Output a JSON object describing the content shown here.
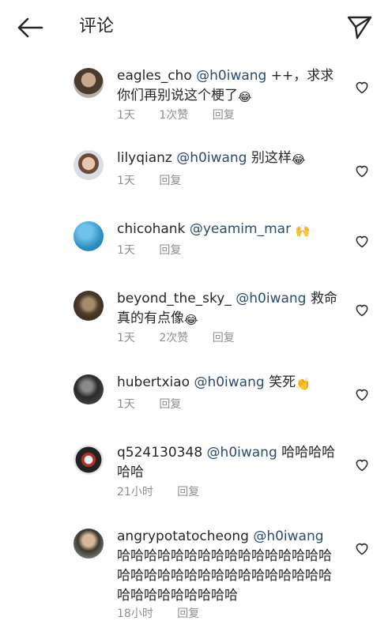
{
  "header": {
    "title": "评论",
    "back_icon": "arrow-left-icon",
    "send_icon": "paper-plane-icon"
  },
  "colors": {
    "mention": "#2b4c6f",
    "meta": "#8e8e8e",
    "text": "#262626"
  },
  "comments": [
    {
      "username": "eagles_cho",
      "mention": "@h0iwang",
      "text": " ++，求求你们再别说这个梗了",
      "emoji": "😂",
      "time": "1天",
      "likes": "1次赞",
      "reply": "回复"
    },
    {
      "username": "lilyqianz",
      "mention": "@h0iwang",
      "text": " 别这样",
      "emoji": "😂",
      "time": "1天",
      "likes": "",
      "reply": "回复"
    },
    {
      "username": "chicohank",
      "mention": "@yeamim_mar",
      "text": " ",
      "emoji": "🙌",
      "time": "1天",
      "likes": "",
      "reply": "回复"
    },
    {
      "username": "beyond_the_sky_",
      "mention": "@h0iwang",
      "text": " 救命真的有点像",
      "emoji": "😂",
      "time": "1天",
      "likes": "2次赞",
      "reply": "回复"
    },
    {
      "username": "hubertxiao",
      "mention": "@h0iwang",
      "text": " 笑死",
      "emoji": "👏",
      "time": "1天",
      "likes": "",
      "reply": "回复"
    },
    {
      "username": "q524130348",
      "mention": "@h0iwang",
      "text": " 哈哈哈哈哈哈",
      "emoji": "",
      "time": "21小时",
      "likes": "",
      "reply": "回复"
    },
    {
      "username": "angrypotatocheong",
      "mention": "@h0iwang",
      "text": " 哈哈哈哈哈哈哈哈哈哈哈哈哈哈哈哈哈哈哈哈哈哈哈哈哈哈哈哈哈哈哈哈哈哈哈哈哈哈哈哈哈",
      "emoji": "",
      "time": "18小时",
      "likes": "",
      "reply": "回复"
    }
  ]
}
